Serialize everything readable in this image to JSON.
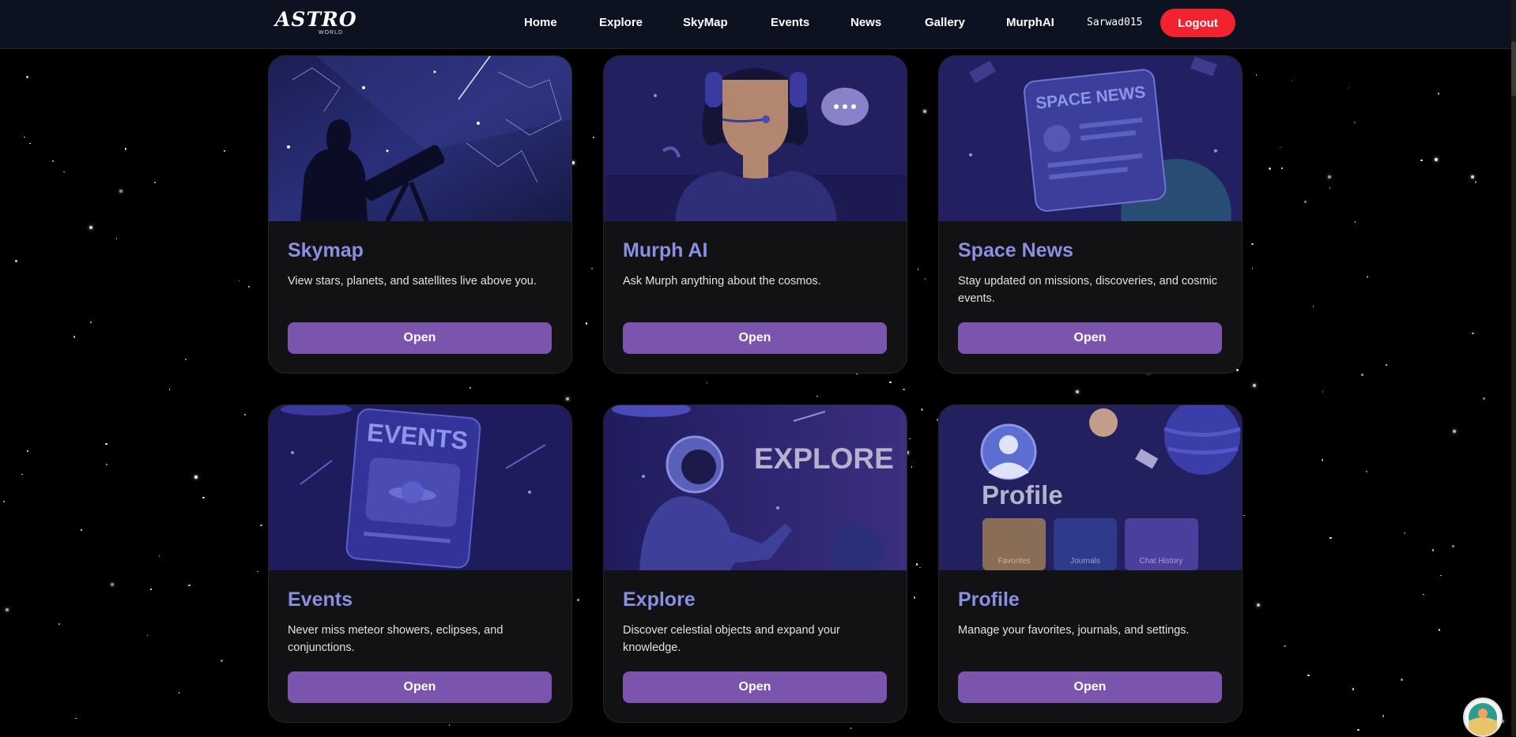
{
  "nav": {
    "logo_main": "ASTRO",
    "logo_sub": "WORLD",
    "links": [
      "Home",
      "Explore",
      "SkyMap",
      "Events",
      "News",
      "Gallery",
      "MurphAI"
    ],
    "username": "Sarwad015",
    "logout_label": "Logout"
  },
  "cards": [
    {
      "title": "Skymap",
      "description": "View stars, planets, and satellites live above you.",
      "button": "Open",
      "icon": "telescope-stargazer-illustration"
    },
    {
      "title": "Murph AI",
      "description": "Ask Murph anything about the cosmos.",
      "button": "Open",
      "icon": "ai-assistant-headset-illustration"
    },
    {
      "title": "Space News",
      "description": "Stay updated on missions, discoveries, and cosmic events.",
      "button": "Open",
      "icon": "space-news-tablet-illustration",
      "image_text": "SPACE NEWS"
    },
    {
      "title": "Events",
      "description": "Never miss meteor showers, eclipses, and conjunctions.",
      "button": "Open",
      "icon": "events-calendar-illustration",
      "image_text": "EVENTS"
    },
    {
      "title": "Explore",
      "description": "Discover celestial objects and expand your knowledge.",
      "button": "Open",
      "icon": "astronaut-explore-illustration",
      "image_text": "EXPLORE"
    },
    {
      "title": "Profile",
      "description": "Manage your favorites, journals, and settings.",
      "button": "Open",
      "icon": "profile-dashboard-illustration",
      "image_text": "Profile",
      "image_tiles": [
        "Favorites",
        "Journals",
        "Chat History"
      ]
    }
  ],
  "colors": {
    "nav_bg": "#0c1220",
    "logout": "#f3222f",
    "card_bg": "#121214",
    "card_title": "#8a8fe3",
    "button": "#7b55ad",
    "image_bg": "#1c1a55"
  }
}
